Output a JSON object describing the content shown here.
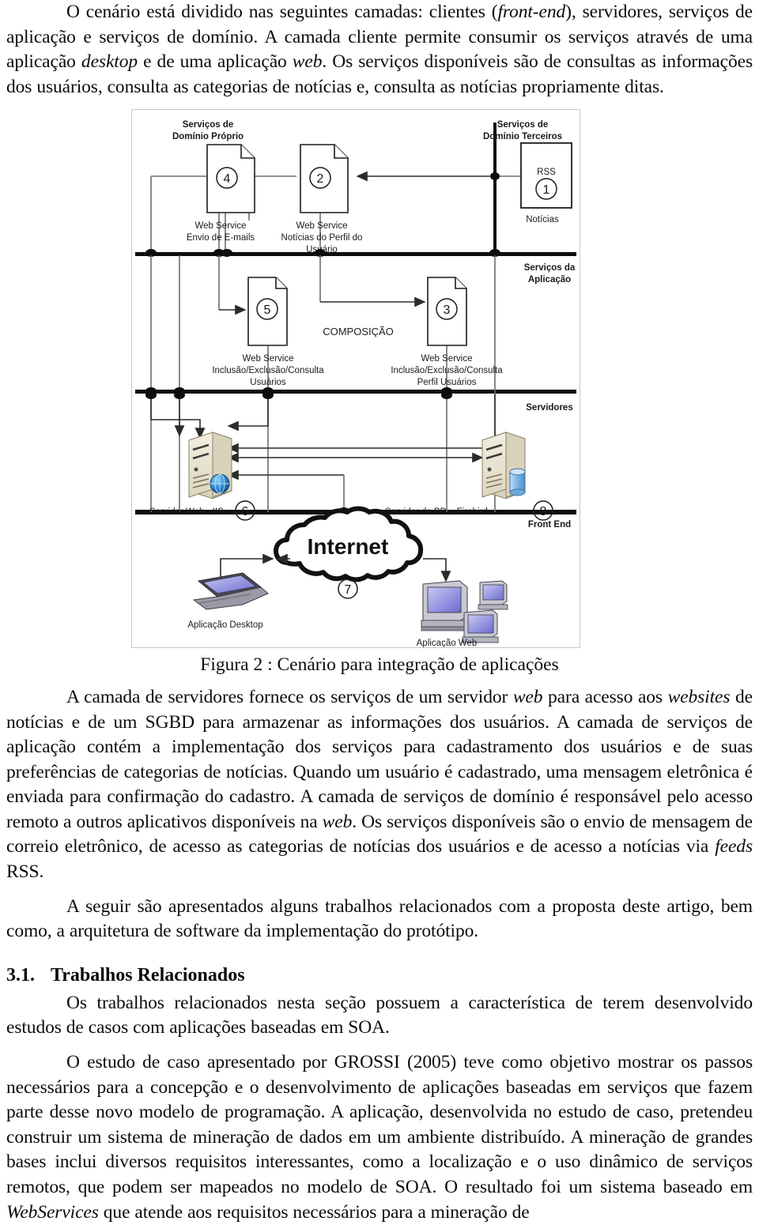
{
  "document": {
    "paragraphs": [
      {
        "id": "p1",
        "runs": [
          {
            "t": "O cenário está dividido nas seguintes camadas: clientes (",
            "style": "normal"
          },
          {
            "t": "front-end",
            "style": "italic"
          },
          {
            "t": "), servidores, serviços de aplicação e serviços de domínio. A camada cliente permite consumir os serviços através de uma aplicação ",
            "style": "normal"
          },
          {
            "t": "desktop",
            "style": "italic"
          },
          {
            "t": " e de uma aplicação ",
            "style": "normal"
          },
          {
            "t": "web",
            "style": "italic"
          },
          {
            "t": ". Os serviços disponíveis são de consultas as informações dos usuários, consulta as categorias de notícias e, consulta as notícias propriamente ditas.",
            "style": "normal"
          }
        ]
      },
      {
        "id": "p2",
        "runs": [
          {
            "t": "A camada de servidores fornece os serviços de um servidor ",
            "style": "normal"
          },
          {
            "t": "web",
            "style": "italic"
          },
          {
            "t": " para acesso aos ",
            "style": "normal"
          },
          {
            "t": "websites",
            "style": "italic"
          },
          {
            "t": " de notícias e de um SGBD para armazenar as informações dos usuários. A camada de serviços de aplicação contém a implementação dos serviços para cadastramento dos usuários e de suas preferências de categorias de notícias. Quando um usuário é cadastrado, uma mensagem eletrônica é enviada para confirmação do cadastro. A camada de serviços de domínio é responsável pelo acesso remoto a outros aplicativos disponíveis na ",
            "style": "normal"
          },
          {
            "t": "web",
            "style": "italic"
          },
          {
            "t": ". Os serviços disponíveis são o envio de mensagem de correio eletrônico, de acesso as categorias de notícias dos usuários e de acesso a notícias via ",
            "style": "normal"
          },
          {
            "t": "feeds",
            "style": "italic"
          },
          {
            "t": " RSS.",
            "style": "normal"
          }
        ]
      },
      {
        "id": "p3",
        "runs": [
          {
            "t": "A seguir são apresentados alguns trabalhos relacionados com a proposta deste artigo, bem como, a arquitetura de software da implementação do protótipo.",
            "style": "normal"
          }
        ]
      },
      {
        "id": "p4",
        "runs": [
          {
            "t": "Os trabalhos relacionados nesta seção possuem a característica de terem desenvolvido estudos de casos com aplicações baseadas em SOA.",
            "style": "normal"
          }
        ]
      },
      {
        "id": "p5",
        "runs": [
          {
            "t": "O estudo de caso apresentado por GROSSI (2005) teve como objetivo mostrar os passos necessários para a concepção e o desenvolvimento de aplicações baseadas em serviços que fazem parte desse novo modelo de programação. A aplicação, desenvolvida no estudo de caso, pretendeu construir um sistema de mineração de dados em um ambiente distribuído. A mineração de grandes bases inclui diversos requisitos interessantes, como a localização e o uso dinâmico de serviços remotos, que podem ser mapeados no modelo de SOA. O resultado foi um sistema baseado em ",
            "style": "normal"
          },
          {
            "t": "WebServices",
            "style": "italic"
          },
          {
            "t": " que atende aos requisitos necessários para a mineração de",
            "style": "normal"
          }
        ]
      }
    ],
    "section_heading": {
      "number": "3.1.",
      "title": "Trabalhos Relacionados"
    },
    "figure_caption": "Figura 2 : Cenário para integração de aplicações"
  },
  "figure": {
    "layer_labels": {
      "domain_own": "Serviços de\nDomínio Próprio",
      "domain_own_l1": "Serviços de",
      "domain_own_l2": "Domínio Próprio",
      "domain_third_l1": "Serviços de",
      "domain_third_l2": "Domínio Terceiros",
      "application_l1": "Serviços da",
      "application_l2": "Aplicação",
      "servers": "Servidores",
      "front_end": "Front End"
    },
    "nodes": [
      {
        "id": "ws4",
        "number": "4",
        "shape": "document",
        "label_lines": [
          "Web Service",
          "Envio de E-mails"
        ]
      },
      {
        "id": "ws2",
        "number": "2",
        "shape": "document",
        "label_lines": [
          "Web Service",
          "Notícias do Perfil do",
          "Usuário"
        ]
      },
      {
        "id": "rss1",
        "number": "1",
        "shape": "rect",
        "title": "RSS",
        "label_lines": [
          "Notícias"
        ]
      },
      {
        "id": "ws5",
        "number": "5",
        "shape": "document",
        "label_lines": [
          "Web Service",
          "Inclusão/Exclusão/Consulta",
          "Usuários"
        ]
      },
      {
        "id": "ws3",
        "number": "3",
        "shape": "document",
        "label_lines": [
          "Web Service",
          "Inclusão/Exclusão/Consulta",
          "Perfil Usuários"
        ]
      },
      {
        "id": "webserver6",
        "number": "6",
        "shape": "server",
        "label_lines": [
          "Servidor Web -  IIS"
        ]
      },
      {
        "id": "dbserver8",
        "number": "8",
        "shape": "server-db",
        "label_lines": [
          "Servidor de BD – Firebird"
        ]
      },
      {
        "id": "internet7",
        "number": "7",
        "shape": "cloud",
        "title": "Internet",
        "label_lines": []
      },
      {
        "id": "desktop-app",
        "number": "",
        "shape": "laptop",
        "label_lines": [
          "Aplicação Desktop"
        ]
      },
      {
        "id": "web-app",
        "number": "",
        "shape": "monitors",
        "label_lines": [
          "Aplicação Web"
        ]
      }
    ],
    "composition_label": "COMPOSIÇÃO",
    "colors": {
      "line": "#6e6e6e",
      "bus": "#0d0d0d",
      "server_body": "#ded7c0",
      "server_face": "#efeadb",
      "screen": "#8f8fe0",
      "globe": "#2f7fd0",
      "db_cylinder": "#7fb8e8",
      "frame": "#c9c9c9"
    }
  }
}
